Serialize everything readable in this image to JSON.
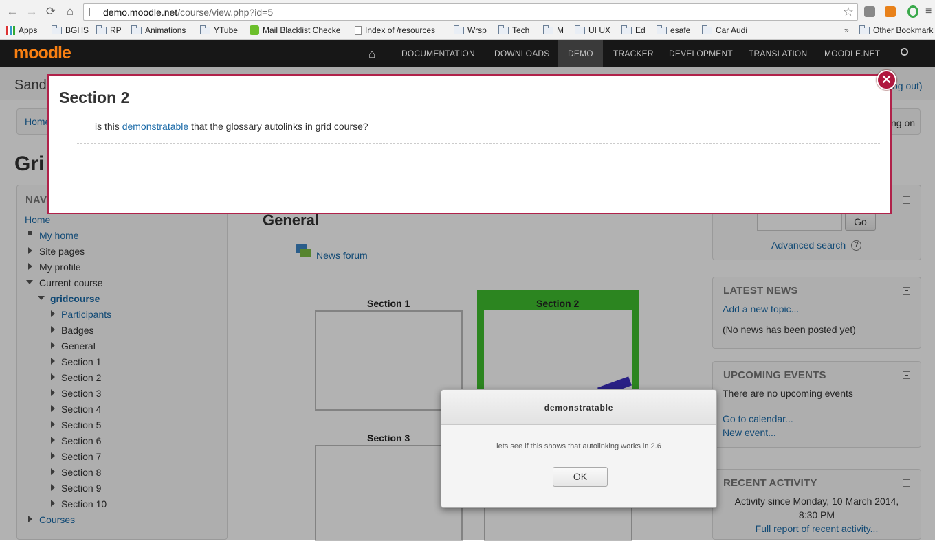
{
  "browser": {
    "url_host": "demo.moodle.net",
    "url_path": "/course/view.php?id=5",
    "bookmarks": [
      "Apps",
      "BGHS",
      "RP",
      "Animations",
      "YTube",
      "Mail Blacklist Checke",
      "Index of /resources",
      "Wrsp",
      "Tech",
      "M",
      "UI UX",
      "Ed",
      "esafe",
      "Car Audi"
    ],
    "more": "»",
    "other_bookmarks": "Other Bookmark"
  },
  "topnav": {
    "logo": "moodle",
    "items": [
      "DOCUMENTATION",
      "DOWNLOADS",
      "DEMO",
      "TRACKER",
      "DEVELOPMENT",
      "TRANSLATION",
      "MOODLE.NET"
    ]
  },
  "page": {
    "site_name_fragment": "Sandl",
    "logout_fragment": "og out)",
    "breadcrumb_home": "Home",
    "login_fragment": "ng on",
    "course_title_fragment": "Gri"
  },
  "navigation": {
    "title_fragment": "NAVI",
    "home": "Home",
    "my_home": "My home",
    "site_pages": "Site pages",
    "my_profile": "My profile",
    "current_course": "Current course",
    "course": "gridcourse",
    "participants": "Participants",
    "badges": "Badges",
    "general": "General",
    "sections": [
      "Section 1",
      "Section 2",
      "Section 3",
      "Section 4",
      "Section 5",
      "Section 6",
      "Section 7",
      "Section 8",
      "Section 9",
      "Section 10"
    ],
    "courses": "Courses"
  },
  "main": {
    "general_heading": "General",
    "news_forum": "News forum",
    "section1": "Section 1",
    "section2": "Section 2",
    "section3": "Section 3"
  },
  "right": {
    "go": "Go",
    "advanced_search": "Advanced search",
    "help_icon": "?",
    "latest_news_title": "LATEST NEWS",
    "add_topic": "Add a new topic...",
    "no_news": "(No news has been posted yet)",
    "upcoming_title": "UPCOMING EVENTS",
    "no_events": "There are no upcoming events",
    "go_calendar": "Go to calendar...",
    "new_event": "New event...",
    "recent_title": "RECENT ACTIVITY",
    "activity_since_1": "Activity since Monday, 10 March 2014,",
    "activity_since_2": "8:30 PM",
    "full_report": "Full report of recent activity..."
  },
  "modal": {
    "title": "Section 2",
    "text_before": "is this ",
    "link": "demonstratable",
    "text_after": " that the glossary autolinks in grid course?",
    "close_glyph": "✕"
  },
  "dialog": {
    "title": "demonstratable",
    "message": "lets see if this shows that autolinking works in 2.6",
    "ok": "OK"
  },
  "colors": {
    "modal_border": "#b0224a",
    "section_highlight": "#3fbf2f",
    "link": "#1a6aa8"
  }
}
